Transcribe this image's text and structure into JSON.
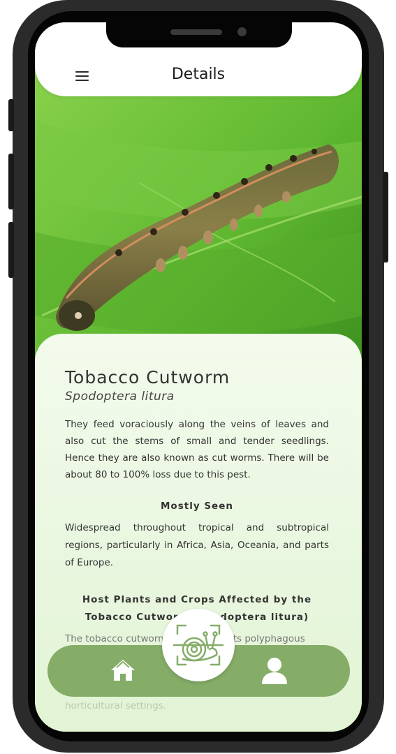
{
  "header": {
    "title": "Details",
    "menu_icon": "hamburger-menu-icon"
  },
  "pest": {
    "common_name": "Tobacco Cutworm",
    "scientific_name": "Spodoptera litura",
    "description": "They feed voraciously along the veins of leaves and also cut the stems of small and tender seedlings. Hence they are also known as cut worms. There will be about 80 to 100% loss due to this pest."
  },
  "sections": {
    "mostly_seen_title": "Mostly Seen",
    "mostly_seen_body": "Widespread throughout tropical and subtropical regions, particularly in Africa, Asia, Oceania, and parts of Europe.",
    "host_title": "Host Plants and Crops Affected by the Tobacco Cutworm (Spodoptera litura)",
    "host_body_start": "The tobacco cutworm is known for its polyphagous",
    "host_body_end": "horticultural settings."
  },
  "nav": {
    "home_icon": "home-icon",
    "scan_icon": "scan-snail-icon",
    "profile_icon": "user-icon"
  },
  "colors": {
    "nav_bg": "#85ad68",
    "card_bg": "#e8f6de",
    "leaf_green": "#6cc23a"
  }
}
